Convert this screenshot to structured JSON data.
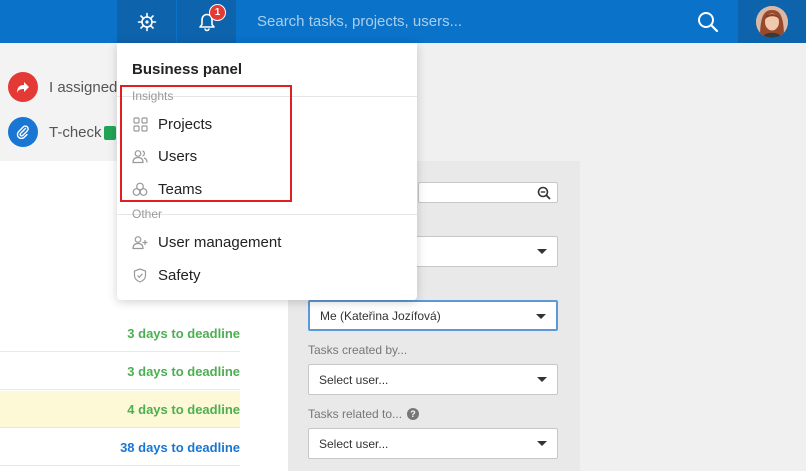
{
  "header": {
    "notification_count": "1",
    "search_placeholder": "Search tasks, projects, users..."
  },
  "activity": [
    {
      "text": "I assigned"
    },
    {
      "text": "T-check"
    }
  ],
  "deadlines": [
    {
      "text": "3 days to deadline",
      "color": "#4caf50"
    },
    {
      "text": "3 days to deadline",
      "color": "#4caf50"
    },
    {
      "text": "4 days to deadline",
      "color": "#4caf50"
    },
    {
      "text": "38 days to deadline",
      "color": "#1976d2"
    }
  ],
  "filters": {
    "assignee_value": "Me (Kateřina Jozífová)",
    "created_by_label": "Tasks created by...",
    "created_by_value": "Select user...",
    "related_to_label": "Tasks related to...",
    "related_to_value": "Select user..."
  },
  "business_panel": {
    "title": "Business panel",
    "insights_label": "Insights",
    "insights_items": [
      {
        "label": "Projects",
        "icon": "grid-icon"
      },
      {
        "label": "Users",
        "icon": "users-icon"
      },
      {
        "label": "Teams",
        "icon": "teams-icon"
      }
    ],
    "other_label": "Other",
    "other_items": [
      {
        "label": "User management",
        "icon": "user-add-icon"
      },
      {
        "label": "Safety",
        "icon": "shield-icon"
      }
    ]
  },
  "colors": {
    "topbar": "#0a72c9",
    "highlight": "#e02020"
  }
}
